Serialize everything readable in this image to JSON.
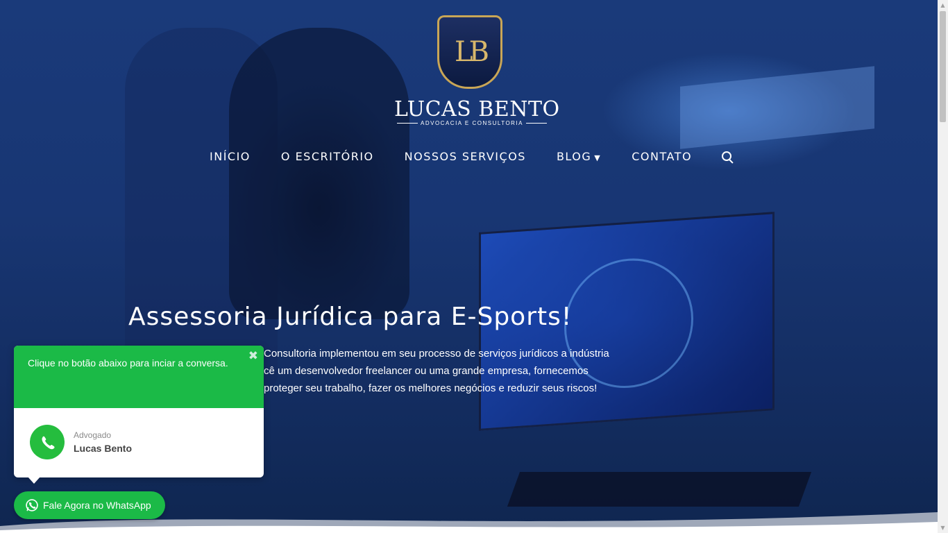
{
  "logo": {
    "monogram": "LB",
    "name": "LUCAS BENTO",
    "subtitle": "ADVOCACIA E CONSULTORIA"
  },
  "nav": {
    "items": [
      {
        "label": "INÍCIO"
      },
      {
        "label": "O ESCRITÓRIO"
      },
      {
        "label": "NOSSOS SERVIÇOS"
      },
      {
        "label": "BLOG"
      },
      {
        "label": "CONTATO"
      }
    ],
    "search_icon": "search-icon",
    "blog_dropdown_icon": "chevron-down-icon"
  },
  "hero": {
    "title": "Assessoria Jurídica para E-Sports!",
    "line1": "Consultoria implementou em seu processo de serviços jurídicos a indústria",
    "line2": "cê um desenvolvedor freelancer ou uma grande empresa, fornecemos",
    "line3": "proteger seu trabalho, fazer os melhores negócios e reduzir seus riscos!"
  },
  "whatsapp": {
    "popup_message": "Clique no botão abaixo para inciar a conversa.",
    "contact_role": "Advogado",
    "contact_name": "Lucas Bento",
    "button_label": "Fale Agora no WhatsApp",
    "close_icon": "close-icon",
    "brand_color": "#1bba47"
  }
}
